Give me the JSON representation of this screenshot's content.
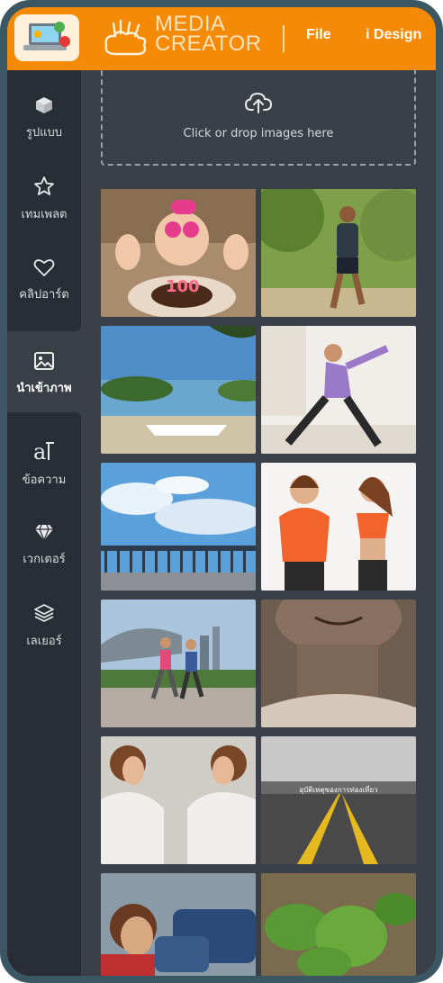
{
  "header": {
    "brand_line1": "MEDIA",
    "brand_line2": "CREATOR",
    "menu": {
      "file": "File",
      "design": "i Design"
    }
  },
  "sidebar": {
    "items": [
      {
        "label": "รูปแบบ",
        "icon": "cube-icon"
      },
      {
        "label": "เทมเพลต",
        "icon": "star-icon"
      },
      {
        "label": "คลิปอาร์ต",
        "icon": "heart-icon"
      },
      {
        "label": "นำเข้าภาพ",
        "icon": "image-icon",
        "active": true
      },
      {
        "label": "ข้อความ",
        "icon": "text-icon"
      },
      {
        "label": "เวกเตอร์",
        "icon": "diamond-icon"
      },
      {
        "label": "เลเยอร์",
        "icon": "layers-icon"
      }
    ]
  },
  "upload": {
    "label": "Click or drop images here",
    "icon": "cloud-upload-icon"
  },
  "gallery": {
    "caption_road": "อุบัติเหตุของการท่องเที่ยว"
  },
  "colors": {
    "accent": "#f58a07",
    "sidebar": "#292d35",
    "panel": "#3b4048",
    "frame": "#3a5763"
  }
}
